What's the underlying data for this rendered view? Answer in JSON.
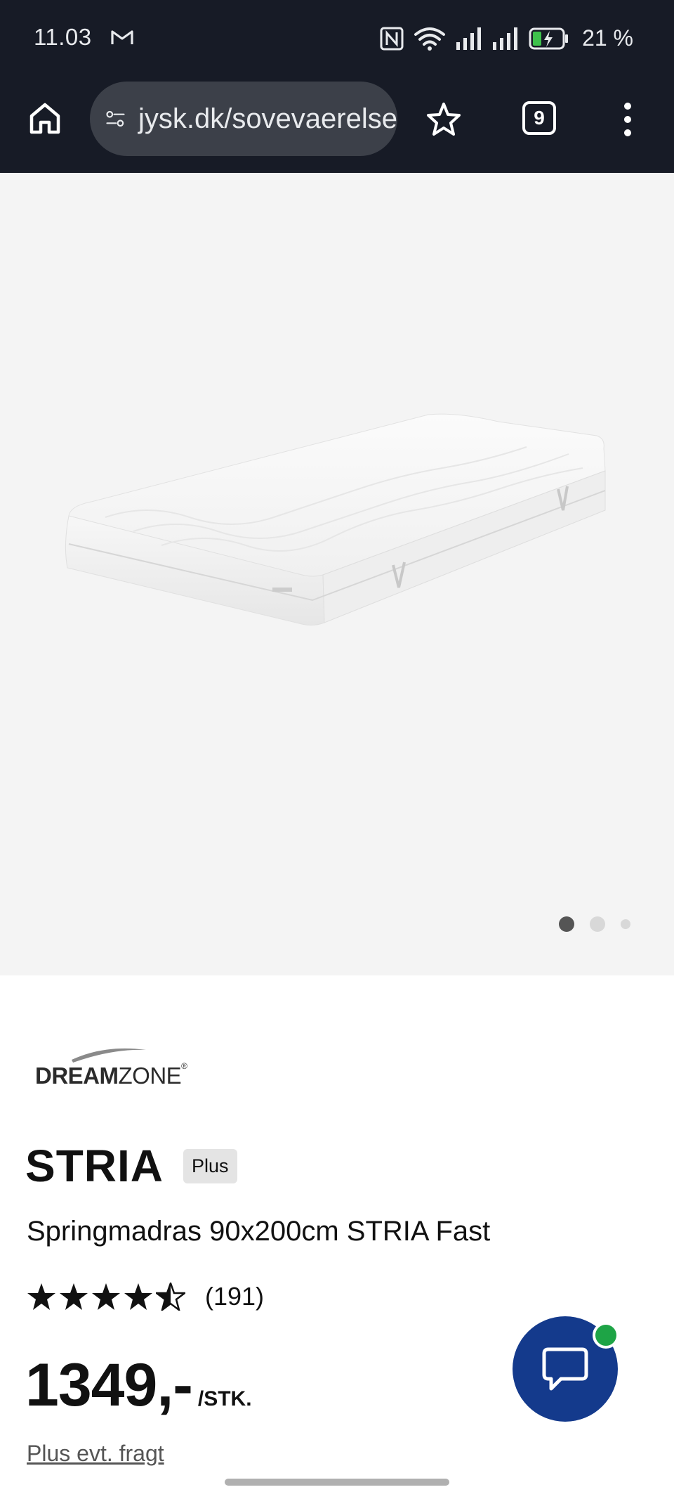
{
  "status_bar": {
    "time": "11.03",
    "battery_text": "21 %",
    "icons": [
      "gmail-icon",
      "nfc-icon",
      "wifi-icon",
      "signal-icon",
      "signal-icon",
      "battery-charging-icon"
    ]
  },
  "browser": {
    "url": "jysk.dk/sovevaerelse",
    "tab_count": "9"
  },
  "gallery": {
    "image_alt": "Springmadras STRIA",
    "slides_total": 3,
    "active_slide": 1
  },
  "product": {
    "brand": {
      "name_bold": "DREAM",
      "name_light": "ZONE",
      "registered": "®"
    },
    "title": "STRIA",
    "badge": "Plus",
    "subtitle": "Springmadras 90x200cm STRIA Fast",
    "rating_value": 4.5,
    "review_count": "(191)",
    "price": "1349,-",
    "price_unit": "/STK.",
    "shipping_note": "Plus evt. fragt"
  },
  "colors": {
    "topbar_bg": "#171b26",
    "urlbar_bg": "#3c4049",
    "gallery_bg": "#f4f4f4",
    "chat_bg": "#143a8c",
    "chat_online": "#1ea446"
  }
}
